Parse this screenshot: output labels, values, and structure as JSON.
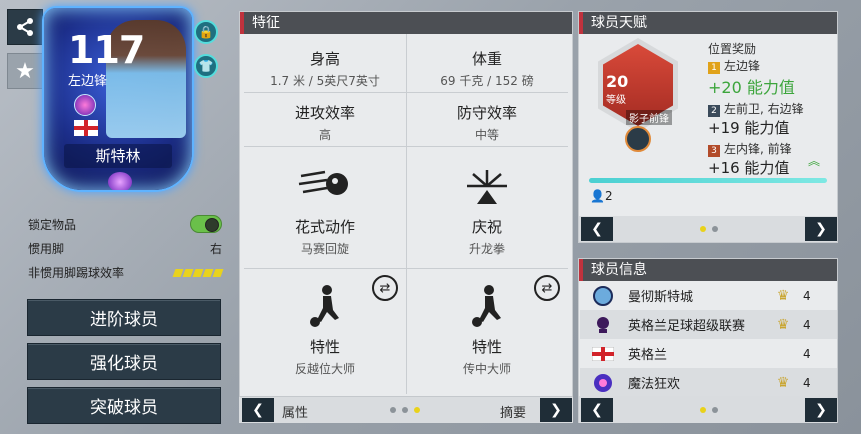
{
  "card": {
    "rating": "117",
    "position": "左边锋",
    "name": "斯特林"
  },
  "left_info": {
    "lock_label": "锁定物品",
    "foot_label": "惯用脚",
    "foot_value": "右",
    "weak_foot_label": "非惯用脚踢球效率",
    "weak_foot_stars": 5
  },
  "buttons": {
    "advance": "进阶球员",
    "enhance": "强化球员",
    "breakthrough": "突破球员"
  },
  "traits_panel": {
    "title": "特征",
    "height_label": "身高",
    "height_value": "1.7 米 / 5英尺7英寸",
    "weight_label": "体重",
    "weight_value": "69 千克 / 152 磅",
    "attack_label": "进攻效率",
    "attack_value": "高",
    "defense_label": "防守效率",
    "defense_value": "中等",
    "skill_label": "花式动作",
    "skill_value": "马赛回旋",
    "celebration_label": "庆祝",
    "celebration_value": "升龙拳",
    "trait1_label": "特性",
    "trait1_value": "反越位大师",
    "trait2_label": "特性",
    "trait2_value": "传中大师",
    "footer_left": "属性",
    "footer_right": "摘要"
  },
  "talent_panel": {
    "title": "球员天赋",
    "level_num": "20",
    "level_label": "等级",
    "skill_name": "影子前锋",
    "position_reward_label": "位置奖励",
    "rewards": [
      {
        "rank": "1",
        "pos": "左边锋",
        "value": "+20 能力值",
        "color": "#e0a21a"
      },
      {
        "rank": "2",
        "pos": "左前卫, 右边锋",
        "value": "+19 能力值",
        "color": "#3a4a5a"
      },
      {
        "rank": "3",
        "pos": "左内锋, 前锋",
        "value": "+16 能力值",
        "color": "#b24b2a"
      }
    ],
    "count": "2",
    "progress": 1.0
  },
  "player_info": {
    "title": "球员信息",
    "rows": [
      {
        "text": "曼彻斯特城",
        "rating": "4"
      },
      {
        "text": "英格兰足球超级联赛",
        "rating": "4"
      },
      {
        "text": "英格兰",
        "rating": "4"
      },
      {
        "text": "魔法狂欢",
        "rating": "4"
      }
    ]
  },
  "colors": {
    "accent_red": "#c0323d",
    "toggle_green": "#6ac04a",
    "dot_active": "#e9d21a",
    "reward_green": "#3ca53c"
  }
}
